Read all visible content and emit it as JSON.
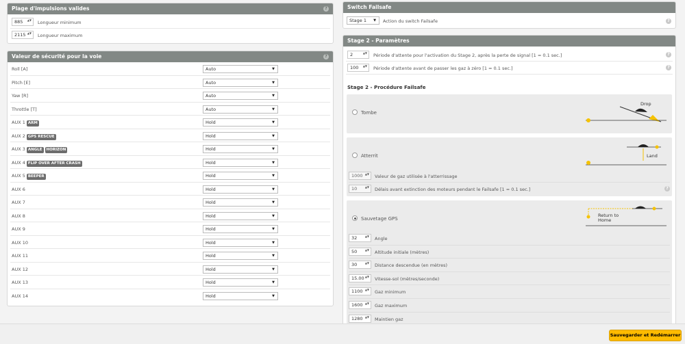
{
  "pulse_range": {
    "title": "Plage d'impulsions valides",
    "rows": [
      {
        "value": "885",
        "label": "Longueur minimum"
      },
      {
        "value": "2115",
        "label": "Longueur maximum"
      }
    ]
  },
  "channel_safety": {
    "title": "Valeur de sécurité pour la voie",
    "rows": [
      {
        "name": "Roll [A]",
        "tags": [],
        "value": "Auto"
      },
      {
        "name": "Pitch [E]",
        "tags": [],
        "value": "Auto"
      },
      {
        "name": "Yaw [R]",
        "tags": [],
        "value": "Auto"
      },
      {
        "name": "Throttle [T]",
        "tags": [],
        "value": "Auto"
      },
      {
        "name": "AUX 1",
        "tags": [
          "ARM"
        ],
        "value": "Hold"
      },
      {
        "name": "AUX 2",
        "tags": [
          "GPS RESCUE"
        ],
        "value": "Hold"
      },
      {
        "name": "AUX 3",
        "tags": [
          "ANGLE",
          "HORIZON"
        ],
        "value": "Hold"
      },
      {
        "name": "AUX 4",
        "tags": [
          "FLIP OVER AFTER CRASH"
        ],
        "value": "Hold"
      },
      {
        "name": "AUX 5",
        "tags": [
          "BEEPER"
        ],
        "value": "Hold"
      },
      {
        "name": "AUX 6",
        "tags": [],
        "value": "Hold"
      },
      {
        "name": "AUX 7",
        "tags": [],
        "value": "Hold"
      },
      {
        "name": "AUX 8",
        "tags": [],
        "value": "Hold"
      },
      {
        "name": "AUX 9",
        "tags": [],
        "value": "Hold"
      },
      {
        "name": "AUX 10",
        "tags": [],
        "value": "Hold"
      },
      {
        "name": "AUX 11",
        "tags": [],
        "value": "Hold"
      },
      {
        "name": "AUX 12",
        "tags": [],
        "value": "Hold"
      },
      {
        "name": "AUX 13",
        "tags": [],
        "value": "Hold"
      },
      {
        "name": "AUX 14",
        "tags": [],
        "value": "Hold"
      }
    ]
  },
  "switch_failsafe": {
    "title": "Switch Failsafe",
    "value": "Stage 1",
    "label": "Action du switch Failsafe"
  },
  "stage2": {
    "title": "Stage 2 - Paramètres",
    "rows": [
      {
        "value": "2",
        "label": "Période d'attente pour l'activation du Stage 2, après la perte de signal [1 = 0.1 sec.]"
      },
      {
        "value": "100",
        "label": "Période d'attente avant de passer les gaz à zéro [1 = 0.1 sec.]"
      }
    ]
  },
  "procedure": {
    "title": "Stage 2 - Procédure Failsafe",
    "drop": {
      "label": "Tombe",
      "diagram_text": "Drop"
    },
    "land": {
      "label": "Atterrit",
      "diagram_text": "Land",
      "rows": [
        {
          "value": "1000",
          "label": "Valeur de gaz utilisée à l'atterrissage"
        },
        {
          "value": "10",
          "label": "Délais avant extinction des moteurs pendant le Failsafe [1 = 0.1 sec.]"
        }
      ]
    },
    "gps": {
      "label": "Sauvetage GPS",
      "diagram_text_1": "Return to",
      "diagram_text_2": "Home",
      "rows": [
        {
          "value": "32",
          "label": "Angle"
        },
        {
          "value": "50",
          "label": "Altitude initiale (mètres)"
        },
        {
          "value": "30",
          "label": "Distance descendue (en mètres)"
        },
        {
          "value": "15.00",
          "label": "Vitesse-sol (mètres/seconde)"
        },
        {
          "value": "1100",
          "label": "Gaz minimum"
        },
        {
          "value": "1600",
          "label": "Gaz maximum"
        },
        {
          "value": "1280",
          "label": "Maintien gaz"
        }
      ]
    }
  },
  "icons": {
    "help": "?",
    "select_arrow": "▼",
    "spin_arrows": "▲▼"
  },
  "footer": {
    "save_label": "Sauvegarder et Redémarrer"
  },
  "colors": {
    "accent": "#ffbb00",
    "header": "#828885"
  }
}
